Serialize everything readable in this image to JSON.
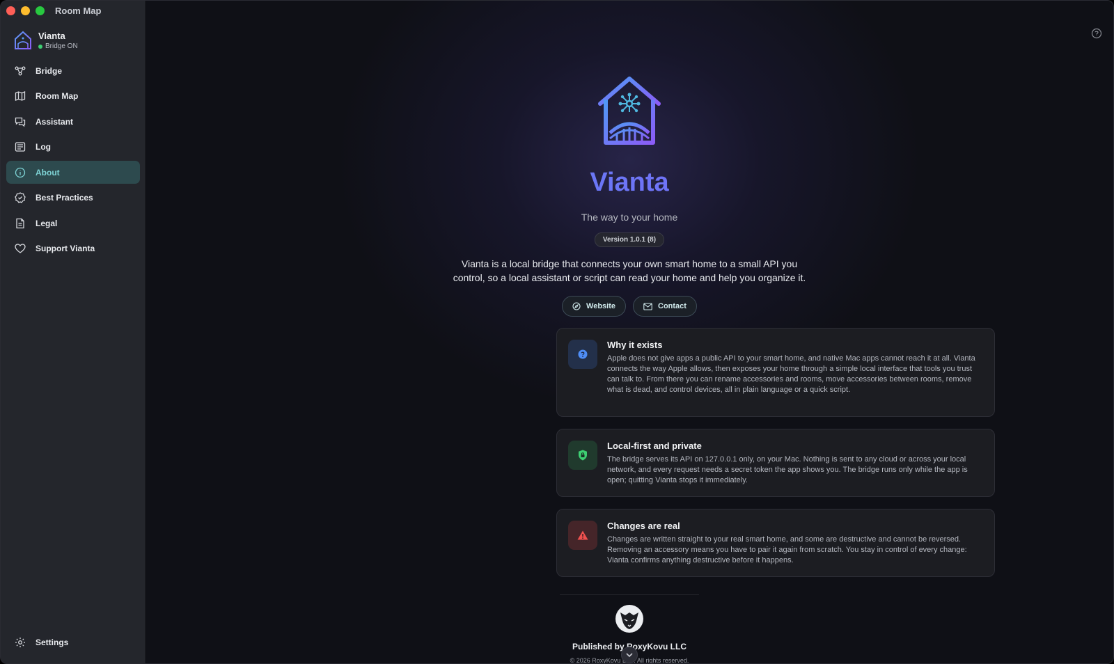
{
  "window": {
    "title": "Room Map"
  },
  "brand": {
    "name": "Vianta",
    "status": "Bridge ON"
  },
  "nav": [
    {
      "label": "Bridge",
      "icon": "bridge-icon"
    },
    {
      "label": "Room Map",
      "icon": "map-icon"
    },
    {
      "label": "Assistant",
      "icon": "chat-icon"
    },
    {
      "label": "Log",
      "icon": "log-icon"
    },
    {
      "label": "About",
      "icon": "info-icon",
      "active": true
    },
    {
      "label": "Best Practices",
      "icon": "check-badge-icon"
    },
    {
      "label": "Legal",
      "icon": "document-icon"
    },
    {
      "label": "Support Vianta",
      "icon": "heart-icon"
    }
  ],
  "settings_label": "Settings",
  "about": {
    "app_name": "Vianta",
    "tagline": "The way to your home",
    "version": "Version 1.0.1 (8)",
    "description": "Vianta is a local bridge that connects your own smart home to a small API you control, so a local assistant or script can read your home and help you organize it.",
    "website_label": "Website",
    "contact_label": "Contact"
  },
  "cards": [
    {
      "title": "Why it exists",
      "body": "Apple does not give apps a public API to your smart home, and native Mac apps cannot reach it at all. Vianta connects the way Apple allows, then exposes your home through a simple local interface that tools you trust can talk to. From there you can rename accessories and rooms, move accessories between rooms, remove what is dead, and control devices, all in plain language or a quick script.",
      "icon": "question-icon",
      "color": "#4f8ef7"
    },
    {
      "title": "Local-first and private",
      "body": "The bridge serves its API on 127.0.0.1 only, on your Mac. Nothing is sent to any cloud or across your local network, and every request needs a secret token the app shows you. The bridge runs only while the app is open; quitting Vianta stops it immediately.",
      "icon": "shield-icon",
      "color": "#3ecf73"
    },
    {
      "title": "Changes are real",
      "body": "Changes are written straight to your real smart home, and some are destructive and cannot be reversed. Removing an accessory means you have to pair it again from scratch. You stay in control of every change: Vianta confirms anything destructive before it happens.",
      "icon": "warning-icon",
      "color": "#f0514f"
    }
  ],
  "footer": {
    "publisher": "Published by RoxyKovu LLC",
    "copyright": "© 2026 RoxyKovu LLC. All rights reserved."
  }
}
